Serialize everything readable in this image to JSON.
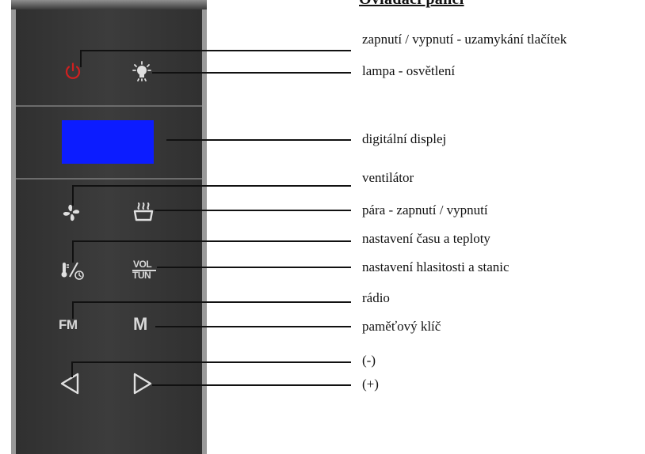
{
  "header": {
    "title": "Ovládací panel"
  },
  "panel": {
    "fm_label": "FM",
    "m_label": "M",
    "vol_label": "VOL",
    "tun_label": "TUN",
    "colors": {
      "body": "#363636",
      "frame": "#9a9a9a",
      "display": "#0c1cff",
      "power": "#d02020",
      "icon": "#d8d8d8"
    }
  },
  "labels": {
    "power": "zapnutí / vypnutí - uzamykání tlačítek",
    "lamp": "lampa - osvětlení",
    "display": "digitální displej",
    "fan": "ventilátor",
    "steam": "pára - zapnutí / vypnutí",
    "time_temp": "nastavení času a teploty",
    "volume_tuning": "nastavení hlasitosti a stanic",
    "radio": "rádio",
    "memory": "paměťový klíč",
    "minus": "(-)",
    "plus": "(+)"
  },
  "icons": {
    "power": "power-icon",
    "lamp": "lamp-icon",
    "fan": "fan-icon",
    "steam": "steam-icon",
    "time_temp": "time-temperature-icon",
    "left": "triangle-left-icon",
    "right": "triangle-right-icon"
  }
}
